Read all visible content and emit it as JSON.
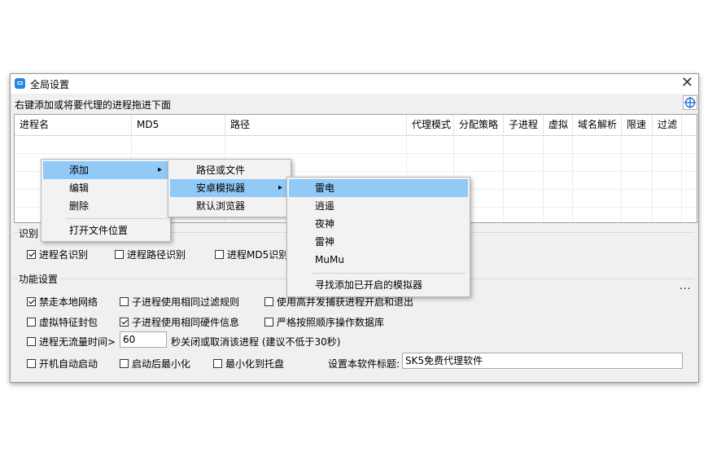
{
  "window": {
    "title": "全局设置",
    "hint": "右键添加或将要代理的进程拖进下面",
    "close": "✕"
  },
  "table": {
    "columns": [
      "进程名",
      "MD5",
      "路径",
      "代理模式",
      "分配策略",
      "子进程",
      "虚拟",
      "域名解析",
      "限速",
      "过滤"
    ]
  },
  "recognition": {
    "group_label": "识别",
    "options": [
      {
        "label": "进程名识别",
        "checked": true
      },
      {
        "label": "进程路径识别",
        "checked": false
      },
      {
        "label": "进程MD5识别",
        "checked": false
      }
    ]
  },
  "features": {
    "group_label": "功能设置",
    "more": "...",
    "row1": [
      {
        "label": "禁走本地网络",
        "checked": true
      },
      {
        "label": "子进程使用相同过滤规则",
        "checked": false
      },
      {
        "label": "使用高并发捕获进程开启和退出",
        "checked": false
      }
    ],
    "row2": [
      {
        "label": "虚拟特征封包",
        "checked": false
      },
      {
        "label": "子进程使用相同硬件信息",
        "checked": true
      },
      {
        "label": "严格按照顺序操作数据库",
        "checked": false
      }
    ],
    "idle": {
      "label": "进程无流量时间>",
      "checked": false,
      "value": "60",
      "suffix": "秒关闭或取消该进程 (建议不低于30秒)"
    },
    "row4": [
      {
        "label": "开机自动启动",
        "checked": false
      },
      {
        "label": "启动后最小化",
        "checked": false
      },
      {
        "label": "最小化到托盘",
        "checked": false
      }
    ],
    "title_label": "设置本软件标题:",
    "title_value": "SK5免费代理软件"
  },
  "context_menu": {
    "items": [
      "添加",
      "编辑",
      "删除",
      "打开文件位置"
    ],
    "submenu": [
      "路径或文件",
      "安卓模拟器",
      "默认浏览器"
    ],
    "emulators": [
      "雷电",
      "逍遥",
      "夜神",
      "雷神",
      "MuMu",
      "寻找添加已开启的模拟器"
    ]
  }
}
